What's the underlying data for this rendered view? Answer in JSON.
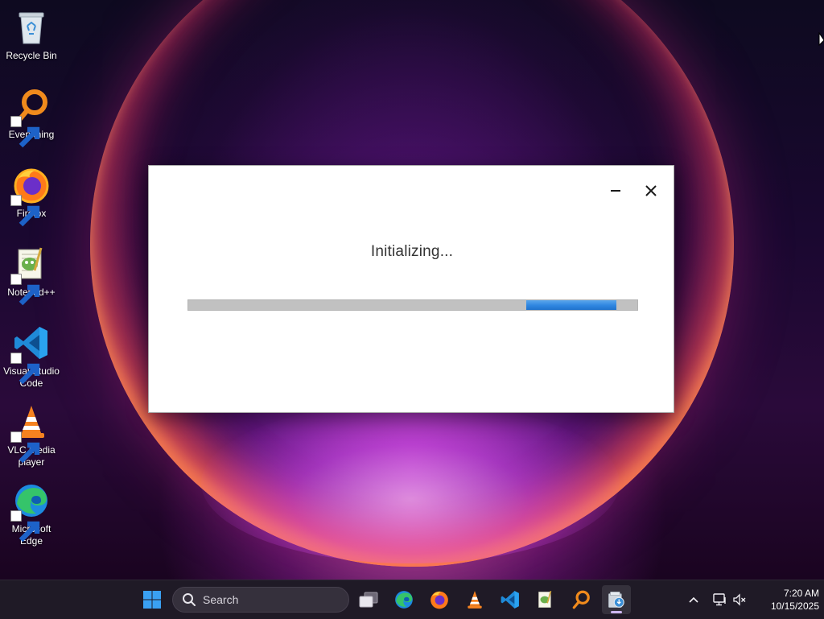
{
  "desktop": {
    "icons": [
      {
        "label": "Recycle Bin",
        "icon": "recycle-bin-icon"
      },
      {
        "label": "Everything",
        "icon": "everything-search-icon"
      },
      {
        "label": "Firefox",
        "icon": "firefox-icon"
      },
      {
        "label": "Notepad++",
        "icon": "notepadpp-icon"
      },
      {
        "label": "Visual Studio Code",
        "icon": "vscode-icon"
      },
      {
        "label": "VLC media player",
        "icon": "vlc-icon"
      },
      {
        "label": "Microsoft Edge",
        "icon": "edge-icon"
      }
    ]
  },
  "dialog": {
    "status": "Initializing...",
    "minimize_icon": "minimize-icon",
    "close_icon": "close-icon",
    "progress": {
      "mode": "indeterminate",
      "color": "#2f86e0",
      "track_color": "#c1c1c1"
    }
  },
  "taskbar": {
    "search_placeholder": "Search",
    "pinned": [
      "start-icon",
      "task-view-icon",
      "edge-icon",
      "firefox-icon",
      "vlc-icon",
      "vscode-icon",
      "notepadpp-icon",
      "everything-search-icon",
      "installer-icon"
    ],
    "active": "installer-icon",
    "tray": [
      "chevron-up-icon",
      "network-icon",
      "volume-muted-icon"
    ],
    "clock": {
      "time": "7:20 AM",
      "date": "10/15/2025"
    }
  },
  "colors": {
    "accent": "#2f86e0",
    "taskbar": "#1f1a26"
  }
}
